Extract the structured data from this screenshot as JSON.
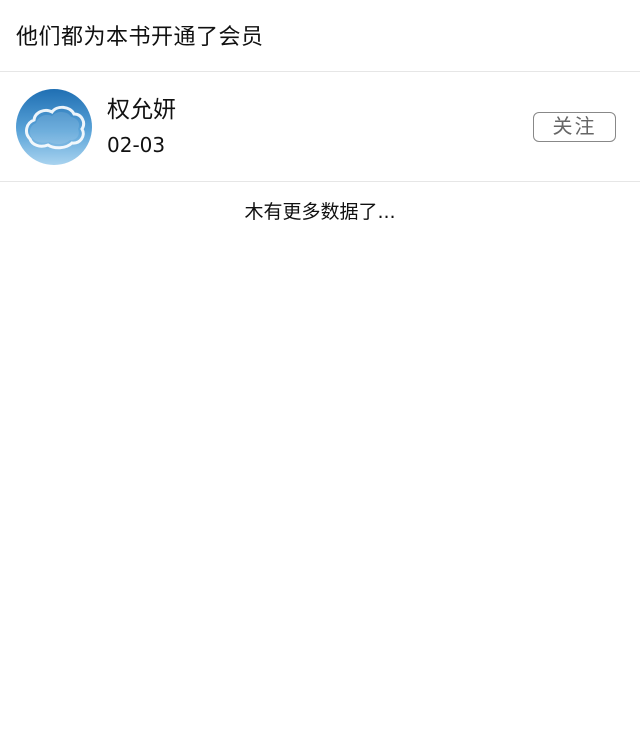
{
  "header": {
    "title": "他们都为本书开通了会员"
  },
  "members": [
    {
      "name": "权允妍",
      "date": "02-03",
      "follow_label": "关注",
      "avatar": "cloud-sky-avatar"
    }
  ],
  "list_end": {
    "message": "木有更多数据了..."
  },
  "colors": {
    "divider": "#e6e6e6",
    "follow_border": "#888888",
    "follow_text": "#666666",
    "avatar_sky_top": "#1f6fb3",
    "avatar_sky_bottom": "#a9d3ef"
  }
}
